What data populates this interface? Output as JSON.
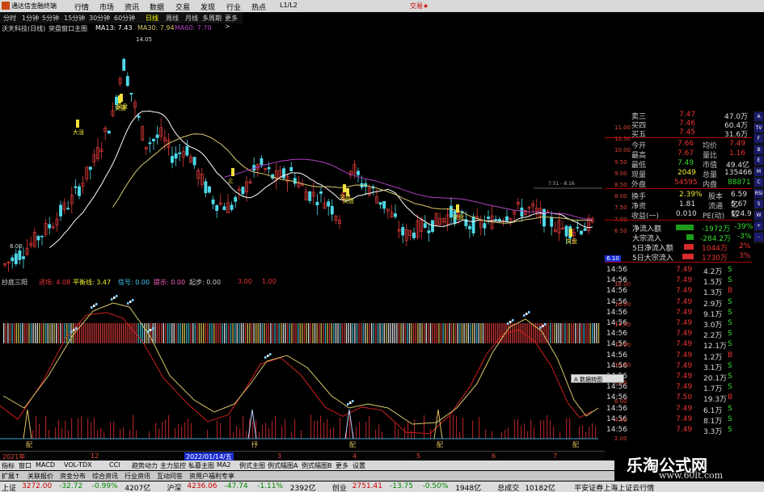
{
  "window": {
    "app_title": "通达信金融终端",
    "menu": [
      "行情",
      "市场",
      "资讯",
      "数据",
      "交易",
      "发现",
      "行业",
      "热点",
      "L1/L2"
    ],
    "right_label": "交易★"
  },
  "periods": {
    "items": [
      "分时",
      "1分钟",
      "5分钟",
      "15分钟",
      "30分钟",
      "60分钟",
      "日线",
      "周线",
      "月线",
      "多周期",
      "更多 >"
    ],
    "active": "日线"
  },
  "main_info": {
    "stock": "沃天科技(日线)",
    "mode": "突盘窗口主图",
    "ma13": "MA13: 7.43",
    "ma30": "MA30: 7.94",
    "ma60": "MA60: 7.70",
    "high_mark": "14.05",
    "low_mark": "6.00",
    "ma13_color": "#ffffff",
    "ma30_color": "#d9c96a",
    "ma60_color": "#b040c0",
    "guide_value": "7.51 - 8.16",
    "current_price_tag": "6.10",
    "signals": [
      "大涨",
      "突盘",
      "突盘",
      "止",
      "突盘",
      "突盘",
      "突盘",
      "突盘"
    ],
    "axis_ticks": [
      "11.00",
      "10.50",
      "10.00",
      "9.50",
      "9.00",
      "8.50",
      "8.00",
      "7.50",
      "7.00",
      "6.50"
    ]
  },
  "sub_info": {
    "name": "抄底三阳",
    "tags": [
      "进场: 4.08",
      "平衡线: 3.47",
      "信号: 0.00",
      "提示: 0.00",
      "起步: 0.00",
      "3.00",
      "1.00"
    ],
    "axis_ticks": [
      "18.00",
      "16.00",
      "14.00",
      "12.00",
      "10.00",
      "8.00",
      "6.00",
      "4.00",
      "2.00"
    ],
    "bottom_labels": [
      "配",
      "抒",
      "配",
      "配",
      "配"
    ],
    "popup_label": "A 数据转图"
  },
  "order_book": [
    {
      "label": "卖三",
      "price": "7.47",
      "vol": "47.0万"
    },
    {
      "label": "买四",
      "price": "7.46",
      "vol": "60.4万"
    },
    {
      "label": "买五",
      "price": "7.45",
      "vol": "31.6万"
    }
  ],
  "quote": [
    {
      "l1": "今开",
      "v1": "7.66",
      "l2": "均价",
      "v2": "7.49"
    },
    {
      "l1": "最高",
      "v1": "7.67",
      "l2": "量比",
      "v2": "1.16"
    },
    {
      "l1": "最低",
      "v1": "7.49",
      "l2": "市值",
      "v2": "49.4亿"
    },
    {
      "l1": "现量",
      "v1": "2049",
      "l2": "总量",
      "v2": "135466"
    },
    {
      "l1": "外盘",
      "v1": "54595",
      "l2": "内盘",
      "v2": "88871"
    },
    {
      "l1": "换手",
      "v1": "2.39%",
      "l2": "股本",
      "v2": "6.59亿"
    },
    {
      "l1": "净资",
      "v1": "1.81",
      "l2": "流通",
      "v2": "5.67亿"
    },
    {
      "l1": "收益(一)",
      "v1": "0.010",
      "l2": "PE(动)",
      "v2": "124.9"
    }
  ],
  "capital_flow": [
    {
      "label": "净流入额",
      "value": "-1972万",
      "pct": "-39%"
    },
    {
      "label": "大宗流入",
      "value": "-284.2万",
      "pct": "-3%"
    },
    {
      "label": "5日净流入额",
      "value": "1044万",
      "pct": "2%"
    },
    {
      "label": "5日大宗流入",
      "value": "1730万",
      "pct": "3%"
    }
  ],
  "ticks": [
    {
      "time": "14:56",
      "price": "7.49",
      "vol": "4.2万",
      "side": "S"
    },
    {
      "time": "14:56",
      "price": "7.49",
      "vol": "1.5万",
      "side": "S"
    },
    {
      "time": "14:56",
      "price": "7.49",
      "vol": "1.3万",
      "side": "B"
    },
    {
      "time": "14:56",
      "price": "7.49",
      "vol": "2.9万",
      "side": "S"
    },
    {
      "time": "14:56",
      "price": "7.49",
      "vol": "9.1万",
      "side": "S"
    },
    {
      "time": "14:56",
      "price": "7.49",
      "vol": "3.0万",
      "side": "S"
    },
    {
      "time": "14:56",
      "price": "7.49",
      "vol": "2.2万",
      "side": "S"
    },
    {
      "time": "14:56",
      "price": "7.49",
      "vol": "12.1万",
      "side": "S"
    },
    {
      "time": "14:56",
      "price": "7.49",
      "vol": "1.2万",
      "side": "B"
    },
    {
      "time": "14:56",
      "price": "7.49",
      "vol": "3.1万",
      "side": "S"
    },
    {
      "time": "14:56",
      "price": "7.49",
      "vol": "20.1万",
      "side": "S"
    },
    {
      "time": "14:56",
      "price": "7.49",
      "vol": "1.7万",
      "side": "S"
    },
    {
      "time": "14:56",
      "price": "7.50",
      "vol": "19.3万",
      "side": "B"
    },
    {
      "time": "14:56",
      "price": "7.49",
      "vol": "6.1万",
      "side": "S"
    },
    {
      "time": "14:56",
      "price": "7.49",
      "vol": "8.1万",
      "side": "S"
    },
    {
      "time": "14:56",
      "price": "7.49",
      "vol": "3.3万",
      "side": "S"
    }
  ],
  "xaxis": {
    "labels": [
      "2021年",
      "12",
      "2022/01/14/五",
      "3",
      "4",
      "5",
      "6",
      "7"
    ]
  },
  "indicator_tabs": [
    "指标",
    "窗口",
    "MACD",
    "VOL-TDX",
    "CCI",
    "趋势动力",
    "主力监控",
    "私募主图",
    "MA2",
    "例式主图",
    "例式幅图A",
    "例式幅图B",
    "更多",
    "设置"
  ],
  "tool_strip": [
    "A",
    "TV",
    "F",
    "B",
    "E",
    "M",
    "C",
    "RSI",
    "S",
    "W",
    "+",
    "-"
  ],
  "nav_tabs": [
    "扩展↑",
    "关联报价",
    "资金分布",
    "综合资讯",
    "行业资讯",
    "互动问答",
    "资用户福利专享"
  ],
  "status": [
    {
      "text": "上证",
      "color": "#000"
    },
    {
      "text": "3272.00",
      "color": "#c00"
    },
    {
      "text": "-32.72",
      "color": "#080"
    },
    {
      "text": "-0.99%",
      "color": "#080"
    },
    {
      "text": "4207亿",
      "color": "#000"
    },
    {
      "text": "沪深",
      "color": "#000"
    },
    {
      "text": "4236.06",
      "color": "#c00"
    },
    {
      "text": "-47.74",
      "color": "#080"
    },
    {
      "text": "-1.11%",
      "color": "#080"
    },
    {
      "text": "2392亿",
      "color": "#000"
    },
    {
      "text": "创业",
      "color": "#000"
    },
    {
      "text": "2751.41",
      "color": "#c00"
    },
    {
      "text": "-13.75",
      "color": "#080"
    },
    {
      "text": "-0.50%",
      "color": "#080"
    },
    {
      "text": "1948亿",
      "color": "#000"
    },
    {
      "text": "总成交",
      "color": "#000"
    },
    {
      "text": "10182亿",
      "color": "#000"
    },
    {
      "text": "平安证券上海上证云行情",
      "color": "#000"
    }
  ],
  "watermark": {
    "line1": "乐淘公式网",
    "line2": "www.60lt.com"
  }
}
